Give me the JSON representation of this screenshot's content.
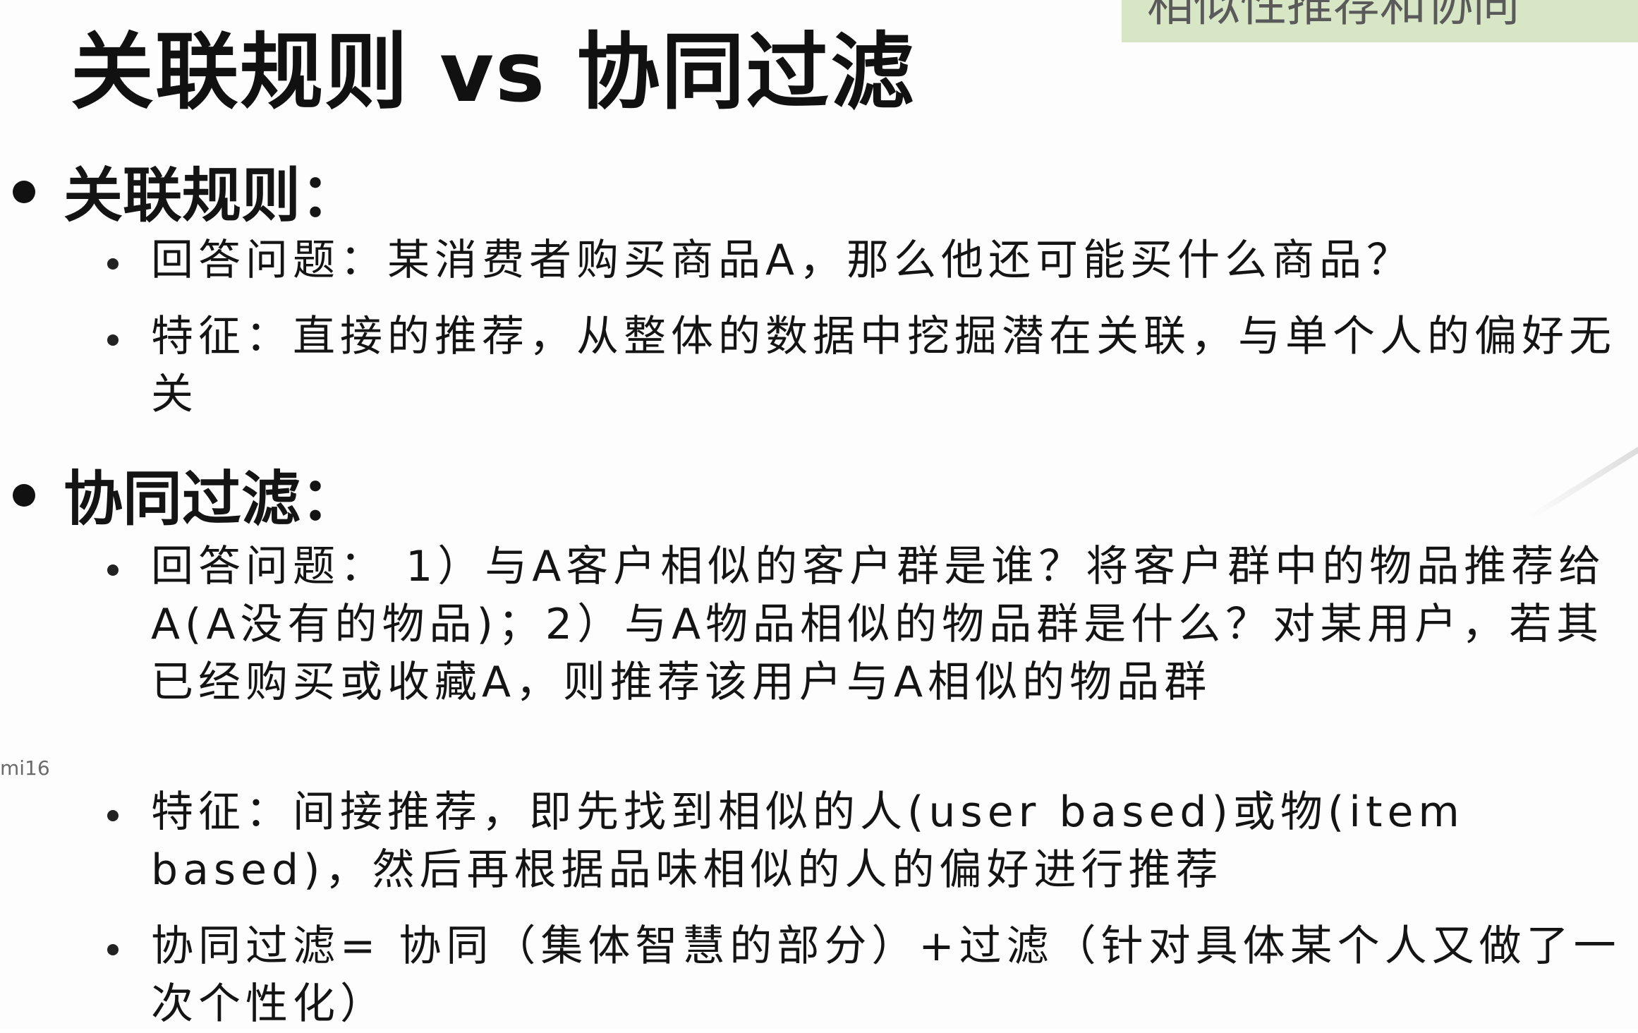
{
  "corner_tag": "相似性推荐和协同",
  "title": "关联规则 vs 协同过滤",
  "sections": [
    {
      "heading": "关联规则：",
      "items": [
        "回答问题：某消费者购买商品A，那么他还可能买什么商品？",
        "特征：直接的推荐，从整体的数据中挖掘潜在关联，与单个人的偏好无关"
      ]
    },
    {
      "heading": "协同过滤：",
      "items": [
        "回答问题： 1）与A客户相似的客户群是谁？将客户群中的物品推荐给A(A没有的物品)；2）与A物品相似的物品群是什么？对某用户，若其已经购买或收藏A，则推荐该用户与A相似的物品群",
        "特征：间接推荐，即先找到相似的人(user based)或物(item based)，然后再根据品味相似的人的偏好进行推荐",
        "协同过滤= 协同（集体智慧的部分）+过滤（针对具体某个人又做了一次个性化）"
      ]
    }
  ],
  "watermark": "mi16"
}
